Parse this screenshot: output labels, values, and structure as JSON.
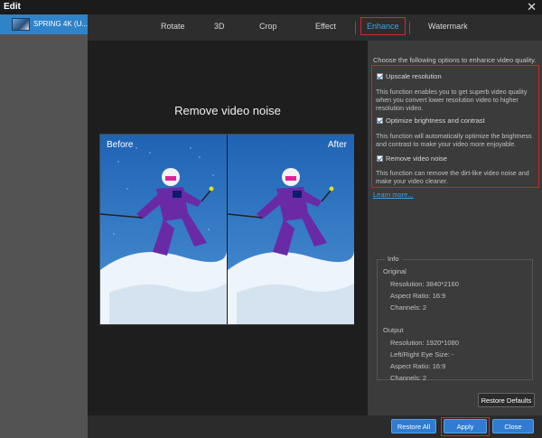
{
  "window": {
    "title": "Edit",
    "close_glyph": "✕"
  },
  "file_list": {
    "items": [
      {
        "name": "SPRING 4K (U..."
      }
    ]
  },
  "tabs": [
    "Rotate",
    "3D",
    "Crop",
    "Effect",
    "Enhance",
    "Watermark"
  ],
  "active_tab": "Enhance",
  "preview": {
    "title": "Remove video noise",
    "before_label": "Before",
    "after_label": "After"
  },
  "enhance": {
    "intro": "Choose the following options to enhance video quality.",
    "options": [
      {
        "label": "Upscale resolution",
        "checked": true,
        "description": "This function enables you to get superb video quality when you convert lower resolution video to higher resolution video."
      },
      {
        "label": "Optimize brightness and contrast",
        "checked": true,
        "description": "This function will automatically optimize the brightness and contrast to make your video more enjoyable."
      },
      {
        "label": "Remove video noise",
        "checked": true,
        "description": "This function can remove the dirt-like video noise and make your video cleaner."
      }
    ],
    "learn_more": "Learn more..."
  },
  "info": {
    "legend": "Info",
    "original_title": "Original",
    "original": [
      "Resolution: 3840*2160",
      "Aspect Ratio: 16:9",
      "Channels: 2"
    ],
    "output_title": "Output",
    "output": [
      "Resolution: 1920*1080",
      "Left/Right Eye Size: -",
      "Aspect Ratio: 16:9",
      "Channels: 2"
    ]
  },
  "buttons": {
    "restore_defaults": "Restore Defaults",
    "restore_all": "Restore All",
    "apply": "Apply",
    "close": "Close"
  },
  "colors": {
    "accent": "#3ea2e6",
    "highlight_red": "#d9262c",
    "selection_blue": "#2f83c9"
  }
}
